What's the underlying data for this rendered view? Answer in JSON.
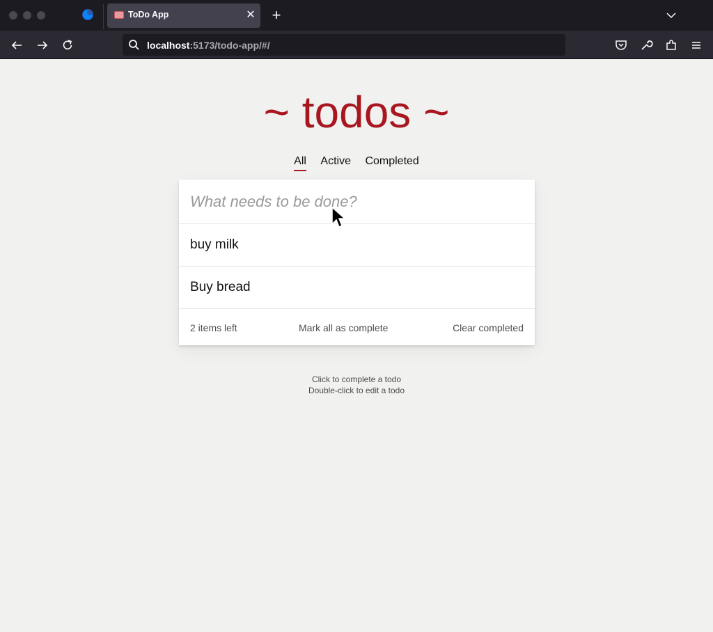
{
  "browser": {
    "tab_title": "ToDo App",
    "tab_close": "✕",
    "new_tab": "+",
    "url_host": "localhost",
    "url_rest": ":5173/todo-app/#/"
  },
  "app": {
    "title": "~ todos ~",
    "filters": [
      "All",
      "Active",
      "Completed"
    ],
    "selected_filter": "All",
    "input_placeholder": "What needs to be done?",
    "input_value": "",
    "todos": [
      "buy milk",
      "Buy bread"
    ],
    "footer": {
      "count": "2 items left",
      "mark_all": "Mark all as complete",
      "clear": "Clear completed"
    },
    "info": {
      "line1": "Click to complete a todo",
      "line2": "Double-click to edit a todo"
    }
  },
  "colors": {
    "accent": "#a8171f",
    "page_bg": "#f1f1f0",
    "chrome_bg": "#1c1b22",
    "toolbar_bg": "#2b2a33"
  }
}
